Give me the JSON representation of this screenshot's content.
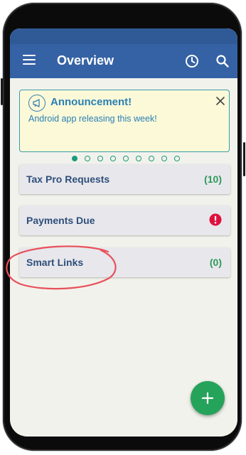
{
  "app": {
    "title": "Overview"
  },
  "toolbar": {
    "menu_icon": "menu-icon",
    "history_icon": "clock-icon",
    "search_icon": "search-icon"
  },
  "announcement": {
    "icon": "megaphone-icon",
    "title": "Announcement!",
    "text": "Android app releasing this week!",
    "dots_total": 9,
    "active_dot": 1
  },
  "cards": [
    {
      "label": "Tax Pro Requests",
      "count": "(10)"
    },
    {
      "label": "Payments Due",
      "status_icon": "alert-icon"
    },
    {
      "label": "Smart Links",
      "count": "(0)"
    }
  ],
  "fab": {
    "icon": "plus-icon"
  },
  "colors": {
    "appbar": "#3562a4",
    "statusbar": "#2f5a96",
    "background": "#f2f2ec",
    "accent_teal": "#1e9a7c",
    "count_green": "#2e9a5a",
    "alert_red": "#e0103e",
    "highlight": "#e8505a"
  }
}
